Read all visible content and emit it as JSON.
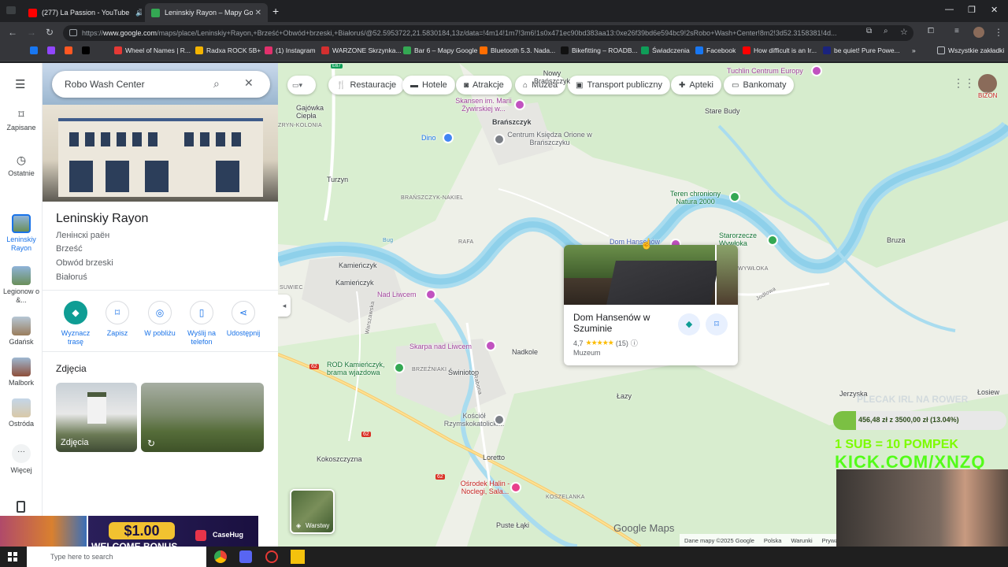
{
  "browser": {
    "tabs": [
      {
        "title": "(277) La Passion - YouTube",
        "favicon_color": "#ff0000",
        "active": false
      },
      {
        "title": "Leninskiy Rayon – Mapy Google",
        "favicon_color": "#34a853",
        "active": true
      }
    ],
    "new_tab": "+",
    "url_prefix": "https://",
    "url_domain": "www.google.com",
    "url_rest": "/maps/place/Leninskiy+Rayon,+Brześć+Obwód+brzeski,+Białoruś/@52.5953722,21.5830184,13z/data=!4m14!1m7!3m6!1s0x471ec90bd383aa13:0xe26f39bd6e594bc9!2sRobo+Wash+Center!8m2!3d52.3158381!4d...",
    "bookmarks": [
      {
        "label": "",
        "color": "#1877f2"
      },
      {
        "label": "",
        "color": "#9146ff"
      },
      {
        "label": "",
        "color": "#ff5722"
      },
      {
        "label": "",
        "color": "#000000"
      },
      {
        "label": "Wheel of Names | R...",
        "color": "#e53935"
      },
      {
        "label": "Radxa ROCK 5B+",
        "color": "#f4b400"
      },
      {
        "label": "(1) Instagram",
        "color": "#e1306c"
      },
      {
        "label": "WARZONE Skrzynka...",
        "color": "#d32f2f"
      },
      {
        "label": "Bar 6 – Mapy Google",
        "color": "#34a853"
      },
      {
        "label": "Bluetooth 5.3. Nada...",
        "color": "#ff6d00"
      },
      {
        "label": "Bikefitting – ROADB...",
        "color": "#111111"
      },
      {
        "label": "Świadczenia",
        "color": "#0f9d58"
      },
      {
        "label": "Facebook",
        "color": "#1877f2"
      },
      {
        "label": "How difficult is an Ir...",
        "color": "#ff0000"
      },
      {
        "label": "be quiet! Pure Powe...",
        "color": "#1a237e"
      }
    ],
    "bookmarks_more": "»",
    "all_bookmarks": "Wszystkie zakładki"
  },
  "rail": {
    "menu": "☰",
    "items": [
      {
        "label": "Zapisane",
        "icon": "bookmark-icon"
      },
      {
        "label": "Ostatnie",
        "icon": "history-icon"
      }
    ],
    "recent": [
      {
        "label": "Leninskiy Rayon",
        "selected": true
      },
      {
        "label": "Legionow o &...",
        "selected": false
      },
      {
        "label": "Gdańsk",
        "selected": false
      },
      {
        "label": "Malbork",
        "selected": false
      },
      {
        "label": "Ostróda",
        "selected": false
      }
    ],
    "more": "Więcej"
  },
  "panel": {
    "search_value": "Robo Wash Center",
    "place_title": "Leninskiy Rayon",
    "address_lines": [
      "Ленінскі раён",
      "Brześć",
      "Obwód brzeski",
      "Białoruś"
    ],
    "actions": [
      {
        "label": "Wyznacz trasę",
        "icon": "directions-icon"
      },
      {
        "label": "Zapisz",
        "icon": "bookmark-icon"
      },
      {
        "label": "W pobliżu",
        "icon": "nearby-icon"
      },
      {
        "label": "Wyślij na telefon",
        "icon": "phone-icon"
      },
      {
        "label": "Udostępnij",
        "icon": "share-icon"
      }
    ],
    "photos_heading": "Zdjęcia",
    "photo_label": "Zdjęcia"
  },
  "map": {
    "chips": [
      {
        "label": "Restauracje",
        "icon": "restaurant-icon"
      },
      {
        "label": "Hotele",
        "icon": "hotel-icon"
      },
      {
        "label": "Atrakcje",
        "icon": "camera-icon"
      },
      {
        "label": "Muzea",
        "icon": "museum-icon"
      },
      {
        "label": "Transport publiczny",
        "icon": "transit-icon"
      },
      {
        "label": "Apteki",
        "icon": "pharmacy-icon"
      },
      {
        "label": "Bankomaty",
        "icon": "atm-icon"
      }
    ],
    "places": {
      "gajowka": "Gajówka Ciepła",
      "zryn": "ZRYN-KOLONIA",
      "skansen": "Skansen im. Marii Żywirskiej w...",
      "branszczyk": "Brańszczyk",
      "centrum": "Centrum Księdza Orione w Brańszczyku",
      "dino": "Dino",
      "nowy": "Nowy Brańszczyk",
      "tuchlin": "Tuchlin Centrum Europy",
      "stare_budy": "Stare Budy",
      "turzyn": "Turzyn",
      "nakiel": "BRAŃSZCZYK-NAKIEL",
      "teren": "Teren chroniony Natura 2000",
      "rafa": "RAFA",
      "dom_hansenow": "Dom Hansenów",
      "starorzecze": "Starorzecze Wywłoka",
      "bruza": "Bruza",
      "kamienczyk1": "Kamieńczyk",
      "kamienczyk2": "Kamieńczyk",
      "suwiec": "SUWIEC",
      "wywloka": "WYWŁOKA",
      "nad_liwcem": "Nad Liwcem",
      "warszawska": "Warszawska",
      "jodlowa": "Jodłowa",
      "skarpa": "Skarpa nad Liwcem",
      "nadkole": "Nadkole",
      "rod": "ROD Kamieńczyk, brama wjazdowa",
      "brzezniaki": "BRZEŹNIAKI",
      "swiniotop": "Świniotop",
      "lazy": "Łazy",
      "jerzyska": "Jerzyska",
      "losiew": "Łosiew",
      "kosciol": "Kościół Rzymskokatolicki...",
      "koko": "Kokoszczyzna",
      "loretto": "Loretto",
      "osrodek": "Ośrodek Halin - Noclegi, Sala...",
      "koszelanka": "KOSZELANKA",
      "puste": "Puste Łąki",
      "bug": "Bug",
      "rabona": "Rabona",
      "r62": "62",
      "e67": "E67",
      "bizon": "BIZON"
    },
    "layers_label": "Warstwy",
    "watermark": "Google Maps",
    "footer": [
      "Dane mapy ©2025 Google",
      "Polska",
      "Warunki",
      "Prywatn"
    ]
  },
  "card": {
    "title": "Dom Hansenów w Szuminie",
    "rating": "4,7",
    "stars": "★★★★★",
    "reviews": "(15)",
    "category": "Muzeum",
    "info": "ⓘ"
  },
  "overlay": {
    "goal_title": "PLECAK IRL NA ROWER",
    "progress_text": "456,48 zł z 3500,00 zł (13.04%)",
    "progress_fraction": 0.1304,
    "sub_line": "1 SUB = 10 POMPEK",
    "kick": "KICK.COM/XNZQ"
  },
  "promo": {
    "amount": "$1.00",
    "text": "WELCOME BONUS",
    "brand": "CaseHug"
  },
  "taskbar": {
    "search_placeholder": "Type here to search"
  }
}
